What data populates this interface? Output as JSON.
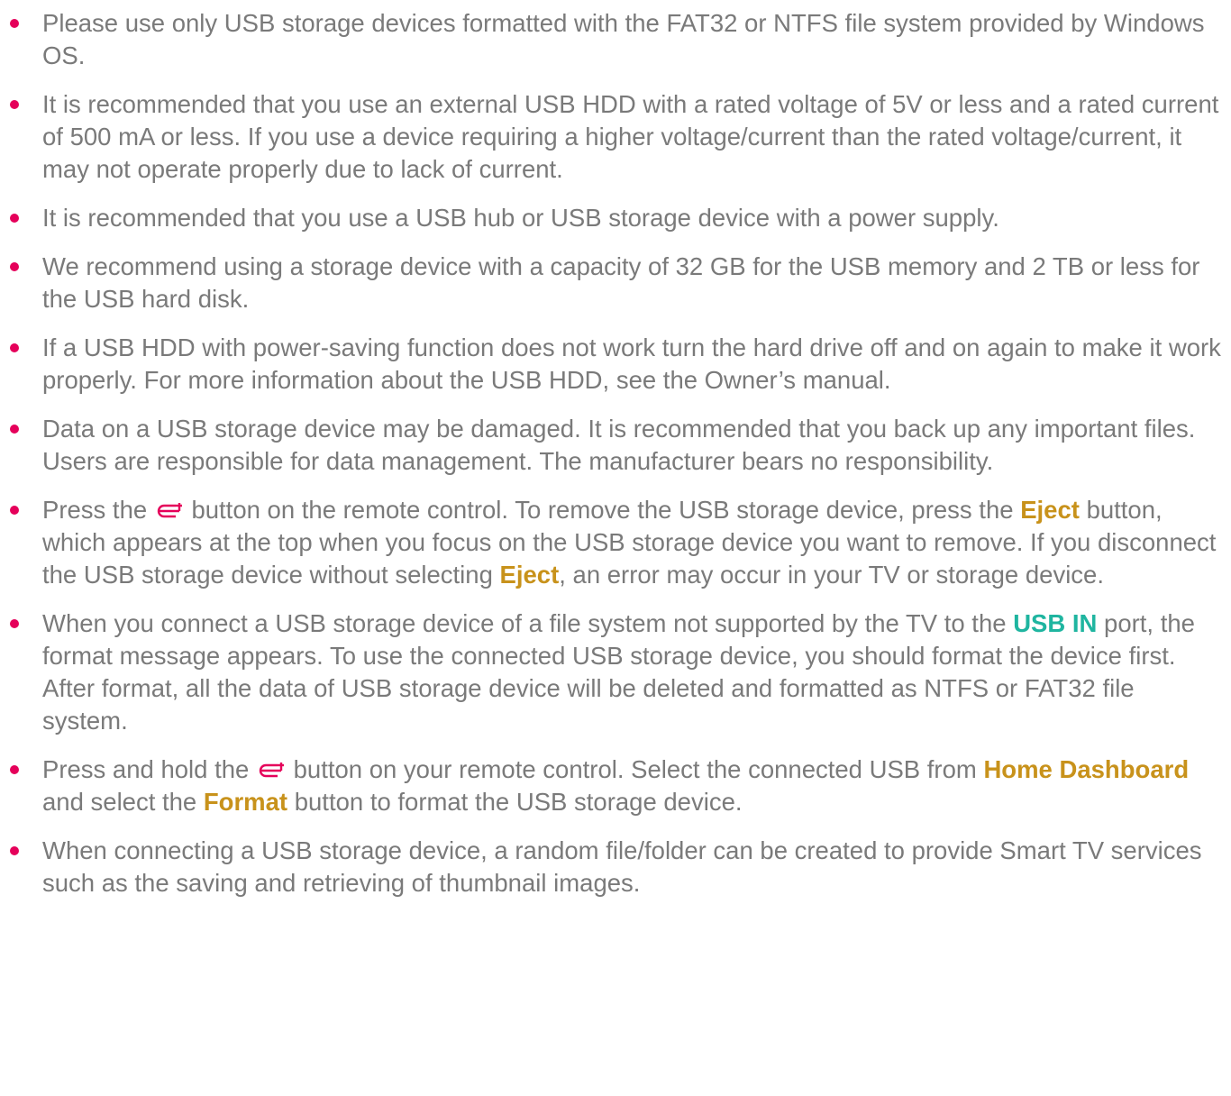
{
  "colors": {
    "bullet": "#e5005a",
    "text": "#7a7a7a",
    "highlight_orange": "#c8921b",
    "highlight_teal": "#1fb5a0",
    "usb_icon": "#e5005a"
  },
  "items": [
    {
      "text": "Please use only USB storage devices formatted with the FAT32 or NTFS file system provided by Windows OS."
    },
    {
      "text": "It is recommended that you use an external USB HDD with a rated voltage of 5V or less and a rated current of 500 mA or less. If you use a device requiring a higher voltage/current than the rated voltage/current, it may not operate properly due to lack of current."
    },
    {
      "text": "It is recommended that you use a USB hub or USB storage device with a power supply."
    },
    {
      "text": "We recommend using a storage device with a capacity of 32 GB for the USB memory and 2 TB or less for the USB hard disk."
    },
    {
      "text": "If a USB HDD with power-saving function does not work turn the hard drive off and on again to make it work properly. For more information about the USB HDD, see the Owner’s manual."
    },
    {
      "text": "Data on a USB storage device may be damaged. It is recommended that you back up any important files. Users are responsible for data management. The manufacturer bears no responsibility."
    },
    {
      "part1": "Press the",
      "icon": "usb-input-icon",
      "part2": "button on the remote control. To remove the USB storage device, press the",
      "eject1": "Eject",
      "part3": "button, which appears at the top when you focus on the USB storage device you want to remove. If you disconnect the USB storage device without selecting",
      "eject2": "Eject",
      "part4": ", an error may occur in your TV or storage device."
    },
    {
      "part1": "When you connect a USB storage device of a file system not supported by the TV to the",
      "usb_in": "USB IN",
      "part2": "port, the format message appears. To use the connected USB storage device, you should format the device first.",
      "part3": "After format, all the data of USB storage device will be deleted and formatted as NTFS or FAT32 file system."
    },
    {
      "part1": "Press and hold the",
      "icon": "usb-input-icon",
      "part2": "button on your remote control. Select the connected USB from",
      "home_dashboard": "Home Dashboard",
      "part3": "and select the",
      "format": "Format",
      "part4": "button to format the USB storage device."
    },
    {
      "text": "When connecting a USB storage device, a random file/folder can be created to provide Smart TV services such as the saving and retrieving of thumbnail images."
    }
  ]
}
